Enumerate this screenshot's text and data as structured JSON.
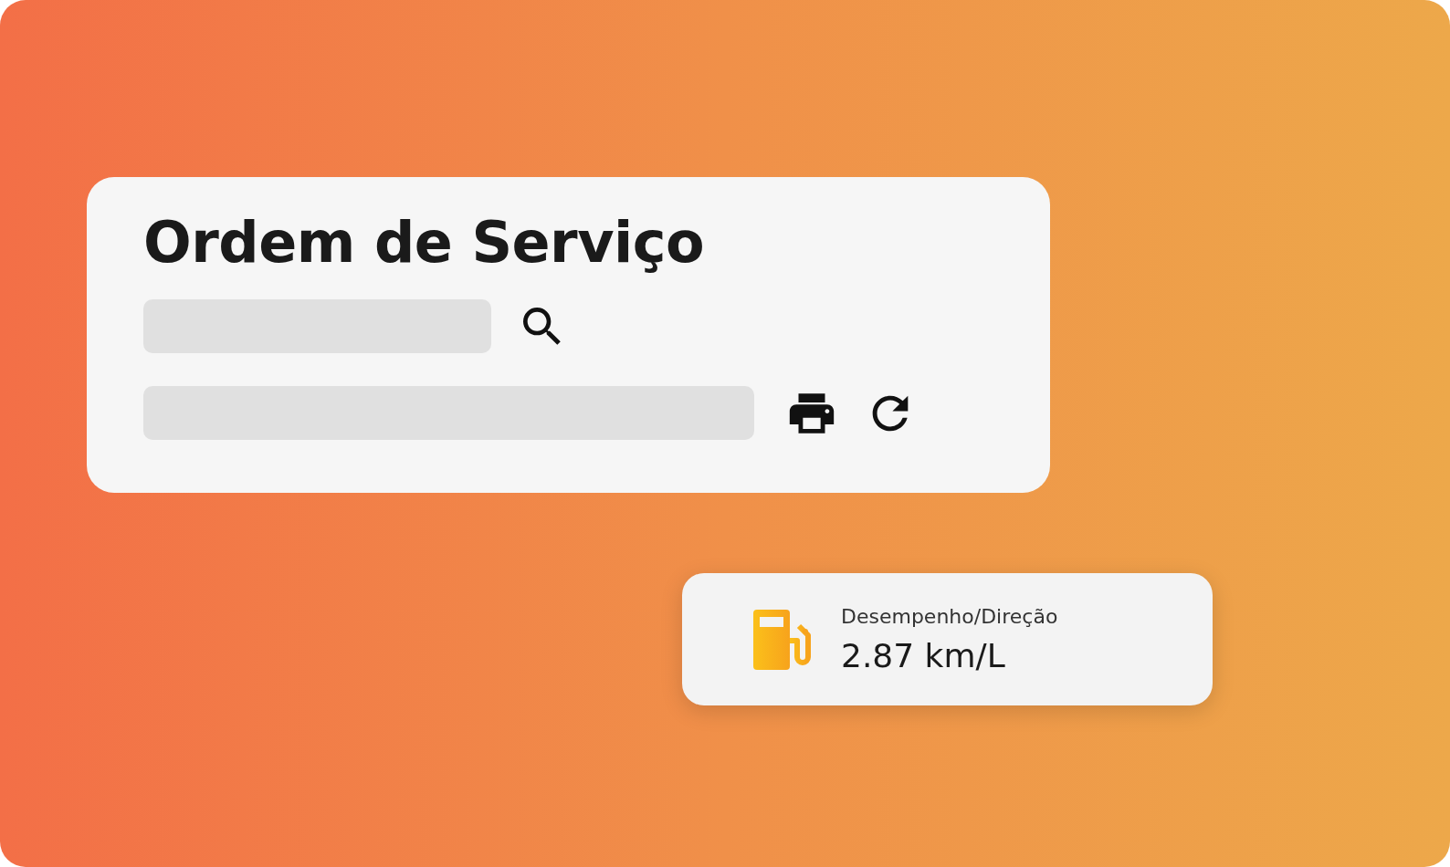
{
  "order_card": {
    "title": "Ordem de Serviço"
  },
  "stat_card": {
    "label": "Desempenho/Direção",
    "value": "2.87 km/L"
  }
}
